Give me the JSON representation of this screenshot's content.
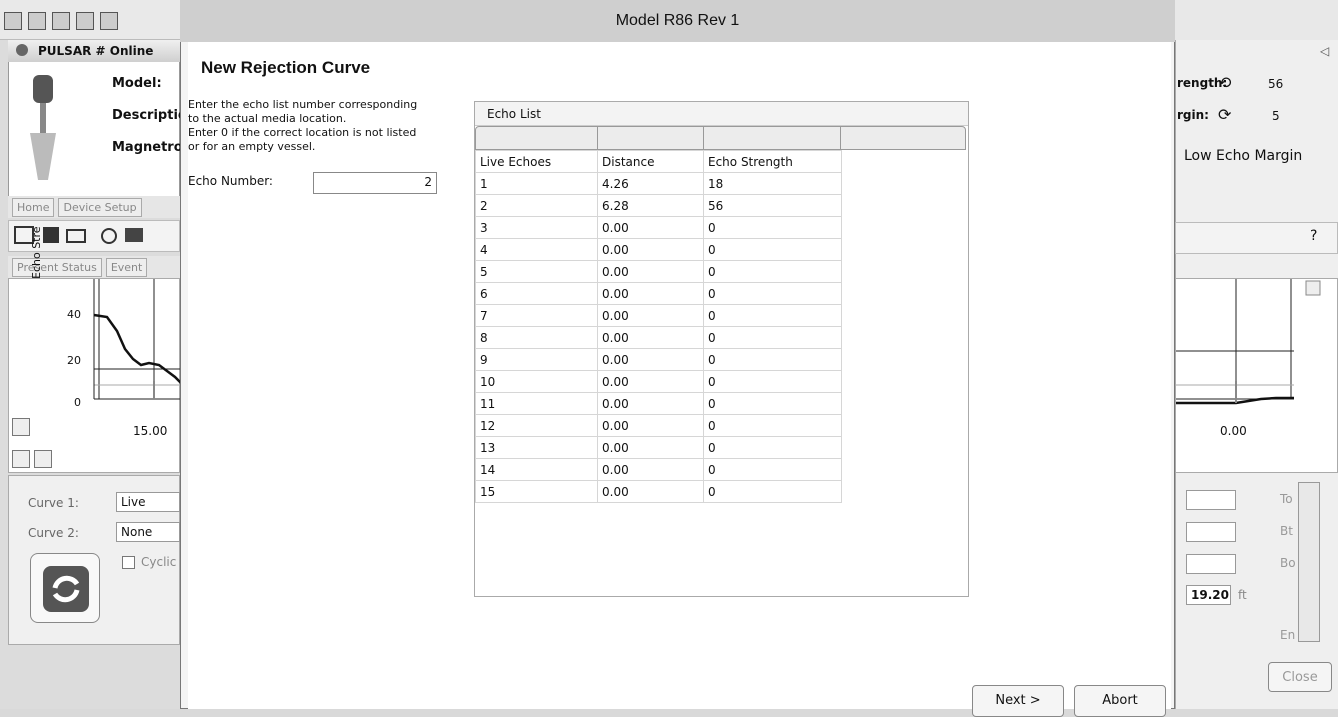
{
  "dialog": {
    "title": "Model R86 Rev 1",
    "heading": "New Rejection Curve",
    "description": [
      "Enter the echo list number corresponding",
      "to the actual media location.",
      "Enter 0 if the correct location is not listed",
      "or for an empty vessel."
    ],
    "echo_number_label": "Echo Number:",
    "echo_number_value": "2",
    "echo_list_title": "Echo List",
    "columns": [
      "Live Echoes",
      "Distance",
      "Echo Strength"
    ],
    "rows": [
      [
        "1",
        "4.26",
        "18"
      ],
      [
        "2",
        "6.28",
        "56"
      ],
      [
        "3",
        "0.00",
        "0"
      ],
      [
        "4",
        "0.00",
        "0"
      ],
      [
        "5",
        "0.00",
        "0"
      ],
      [
        "6",
        "0.00",
        "0"
      ],
      [
        "7",
        "0.00",
        "0"
      ],
      [
        "8",
        "0.00",
        "0"
      ],
      [
        "9",
        "0.00",
        "0"
      ],
      [
        "10",
        "0.00",
        "0"
      ],
      [
        "11",
        "0.00",
        "0"
      ],
      [
        "12",
        "0.00",
        "0"
      ],
      [
        "13",
        "0.00",
        "0"
      ],
      [
        "14",
        "0.00",
        "0"
      ],
      [
        "15",
        "0.00",
        "0"
      ]
    ],
    "next_label": "Next >",
    "abort_label": "Abort"
  },
  "background_left": {
    "window_title": "PULSAR # Online",
    "model_label": "Model:",
    "description_label": "Descriptio",
    "magnetro_label": "Magnetro",
    "tabs": [
      "Home",
      "Device Setup"
    ],
    "sub_tabs": [
      "Present Status",
      "Event"
    ],
    "y_axis_label": "Echo Stre",
    "y_ticks": [
      "40",
      "20",
      "0"
    ],
    "x_tick": "15.00",
    "curve1_label": "Curve 1:",
    "curve1_value": "Live",
    "curve2_label": "Curve 2:",
    "curve2_value": "None",
    "cyclic_label": "Cyclic"
  },
  "background_right": {
    "strength_label": "rength:",
    "strength_value": "56",
    "margin_label": "rgin:",
    "margin_value": "5",
    "status_text": "Low Echo Margin",
    "x_tick": "0.00",
    "side_labels": [
      "To",
      "Bt",
      "Bo",
      "En"
    ],
    "value": "19.20",
    "unit": "ft",
    "close_label": "Close"
  }
}
